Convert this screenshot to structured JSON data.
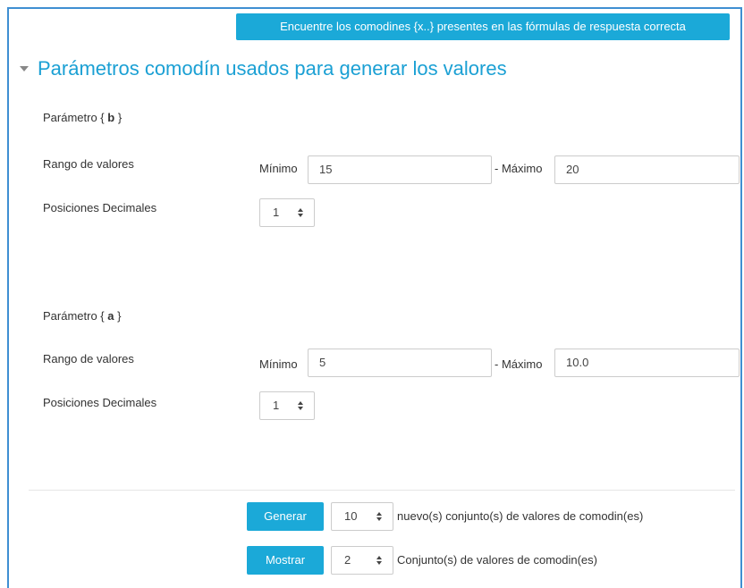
{
  "top_button": {
    "label": "Encuentre los comodines {x..} presentes en las fórmulas de respuesta correcta"
  },
  "section": {
    "title": "Parámetros comodín usados para generar los valores"
  },
  "params": [
    {
      "prefix": "Parámetro {",
      "name": "b",
      "suffix": "}",
      "range_label": "Rango de valores",
      "min_label": "Mínimo",
      "min_value": "15",
      "max_label": "- Máximo",
      "max_value": "20",
      "decimals_label": "Posiciones Decimales",
      "decimals_value": "1"
    },
    {
      "prefix": "Parámetro {",
      "name": "a",
      "suffix": "}",
      "range_label": "Rango de valores",
      "min_label": "Mínimo",
      "min_value": "5",
      "max_label": "- Máximo",
      "max_value": "10.0",
      "decimals_label": "Posiciones Decimales",
      "decimals_value": "1"
    }
  ],
  "generate": {
    "button_label": "Generar",
    "count": "10",
    "text": "nuevo(s) conjunto(s) de valores de comodin(es)"
  },
  "show": {
    "button_label": "Mostrar",
    "count": "2",
    "text": "Conjunto(s) de valores de comodin(es)"
  }
}
